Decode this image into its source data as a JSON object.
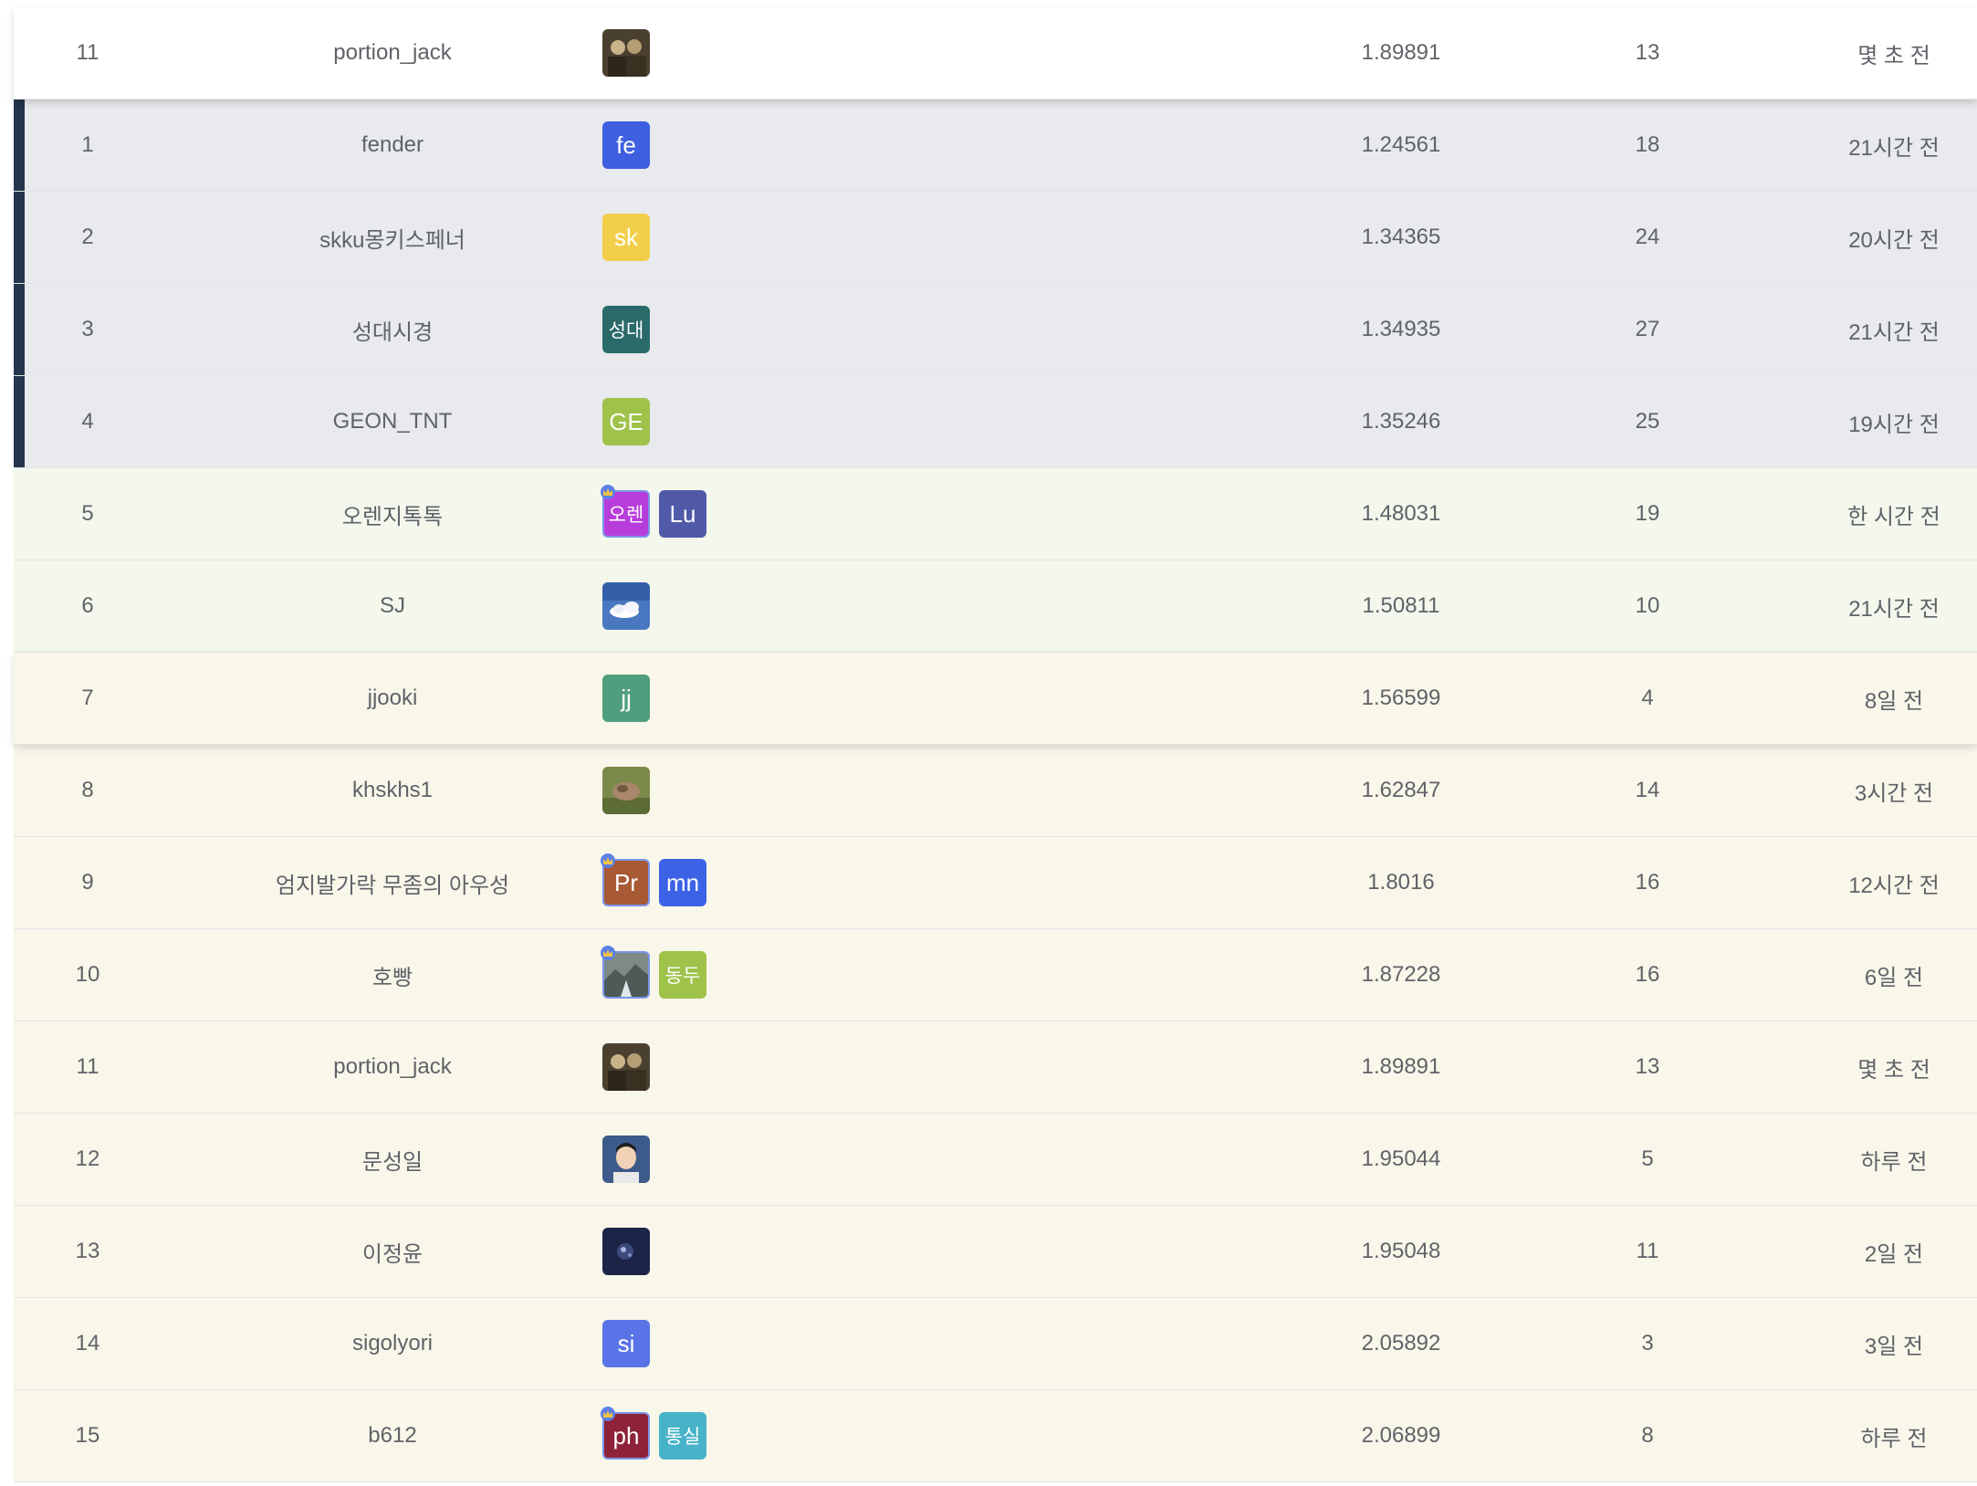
{
  "current_user_row": {
    "rank": "11",
    "name": "portion_jack",
    "score": "1.89891",
    "entries": "13",
    "time": "몇 초 전"
  },
  "rows": [
    {
      "rank": "1",
      "name": "fender",
      "score": "1.24561",
      "entries": "18",
      "time": "21시간 전",
      "avatars": [
        {
          "text": "fe",
          "color": "#3d5fe0"
        }
      ]
    },
    {
      "rank": "2",
      "name": "skku몽키스페너",
      "score": "1.34365",
      "entries": "24",
      "time": "20시간 전",
      "avatars": [
        {
          "text": "sk",
          "color": "#f2cf4a"
        }
      ]
    },
    {
      "rank": "3",
      "name": "성대시경",
      "score": "1.34935",
      "entries": "27",
      "time": "21시간 전",
      "avatars": [
        {
          "text": "성대",
          "color": "#2a6a6a"
        }
      ]
    },
    {
      "rank": "4",
      "name": "GEON_TNT",
      "score": "1.35246",
      "entries": "25",
      "time": "19시간 전",
      "avatars": [
        {
          "text": "GE",
          "color": "#9ec24a"
        }
      ]
    },
    {
      "rank": "5",
      "name": "오렌지톡톡",
      "score": "1.48031",
      "entries": "19",
      "time": "한 시간 전",
      "avatars": [
        {
          "text": "오렌",
          "color": "#b73ddb",
          "leader": true
        },
        {
          "text": "Lu",
          "color": "#505aa8"
        }
      ]
    },
    {
      "rank": "6",
      "name": "SJ",
      "score": "1.50811",
      "entries": "10",
      "time": "21시간 전",
      "avatars": [
        {
          "icon": "sky-cloud-photo",
          "color": "#4a78c0"
        }
      ]
    },
    {
      "rank": "7",
      "name": "jjooki",
      "score": "1.56599",
      "entries": "4",
      "time": "8일 전",
      "avatars": [
        {
          "text": "jj",
          "color": "#4f9e7d"
        }
      ]
    },
    {
      "rank": "8",
      "name": "khskhs1",
      "score": "1.62847",
      "entries": "14",
      "time": "3시간 전",
      "avatars": [
        {
          "icon": "hand-photo",
          "color": "#7b8a4a"
        }
      ]
    },
    {
      "rank": "9",
      "name": "엄지발가락 무좀의 아우성",
      "score": "1.8016",
      "entries": "16",
      "time": "12시간 전",
      "avatars": [
        {
          "text": "Pr",
          "color": "#a85a35",
          "leader": true
        },
        {
          "text": "mn",
          "color": "#3c63e6"
        }
      ]
    },
    {
      "rank": "10",
      "name": "호빵",
      "score": "1.87228",
      "entries": "16",
      "time": "6일 전",
      "avatars": [
        {
          "icon": "rock-photo",
          "color": "#7d8a86",
          "leader": true
        },
        {
          "text": "동두",
          "color": "#9ec24a"
        }
      ]
    },
    {
      "rank": "11",
      "name": "portion_jack",
      "score": "1.89891",
      "entries": "13",
      "time": "몇 초 전",
      "avatars": [
        {
          "icon": "vintage-photo",
          "color": "#4a4030"
        }
      ]
    },
    {
      "rank": "12",
      "name": "문성일",
      "score": "1.95044",
      "entries": "5",
      "time": "하루 전",
      "avatars": [
        {
          "icon": "portrait-photo",
          "color": "#3c5a8a"
        }
      ]
    },
    {
      "rank": "13",
      "name": "이정윤",
      "score": "1.95048",
      "entries": "11",
      "time": "2일 전",
      "avatars": [
        {
          "icon": "dark-night-photo",
          "color": "#1c2447"
        }
      ]
    },
    {
      "rank": "14",
      "name": "sigolyori",
      "score": "2.05892",
      "entries": "3",
      "time": "3일 전",
      "avatars": [
        {
          "text": "si",
          "color": "#5874e6"
        }
      ]
    },
    {
      "rank": "15",
      "name": "b612",
      "score": "2.06899",
      "entries": "8",
      "time": "하루 전",
      "avatars": [
        {
          "text": "ph",
          "color": "#8e2238",
          "leader": true
        },
        {
          "text": "통실",
          "color": "#47b3c8"
        }
      ]
    }
  ]
}
